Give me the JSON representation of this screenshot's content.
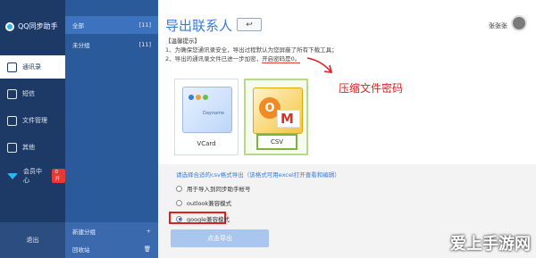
{
  "app": {
    "name": "QQ同步助手"
  },
  "sidebar": {
    "items": [
      {
        "label": "通讯录",
        "icon": "contacts-icon"
      },
      {
        "label": "短信",
        "icon": "message-icon"
      },
      {
        "label": "文件管理",
        "icon": "folder-icon"
      },
      {
        "label": "其他",
        "icon": "grid-icon"
      },
      {
        "label": "会员中心",
        "icon": "diamond-icon",
        "badge": "0开"
      }
    ],
    "logout": "退出"
  },
  "groups": {
    "rows": [
      {
        "label": "全部",
        "count": "[11]"
      },
      {
        "label": "未分组",
        "count": "[11]"
      }
    ],
    "footer": {
      "new_group": "新建分组",
      "new_group_icon": "+",
      "recycle": "回收站",
      "recycle_icon": "🗑"
    }
  },
  "header": {
    "title": "导出联系人",
    "back_icon": "↩",
    "user_name": "张张张"
  },
  "tips": {
    "title": "【温馨提示】",
    "line1": "1、为确保您通讯录安全，导出过程默认为您屏蔽了所有下载工具；",
    "line2_prefix": "2、导出的通讯录文件已进一步加密，",
    "line2_mark": "开启密码是0。"
  },
  "annotation": "压缩文件密码",
  "formats": [
    {
      "label": "VCard",
      "icon": "vcard-icon"
    },
    {
      "label": "CSV",
      "icon": "csv-outlook-gmail-icon"
    }
  ],
  "vcard_preview": "Dayname",
  "options": {
    "title": "请选择合适的csv格式导出（该格式可用excel打开查看和编辑）",
    "items": [
      {
        "label": "用于导入到同步助手帐号",
        "checked": false
      },
      {
        "label": "outlook兼容模式",
        "checked": false
      },
      {
        "label": "google兼容模式",
        "checked": true
      }
    ],
    "export_button": "点击导出"
  },
  "watermark": "爱上手游网",
  "colors": {
    "sidebar": "#1d3a66",
    "groups": "#2b5a9a",
    "accent": "#3a7bd5",
    "annotation": "#e02020"
  }
}
